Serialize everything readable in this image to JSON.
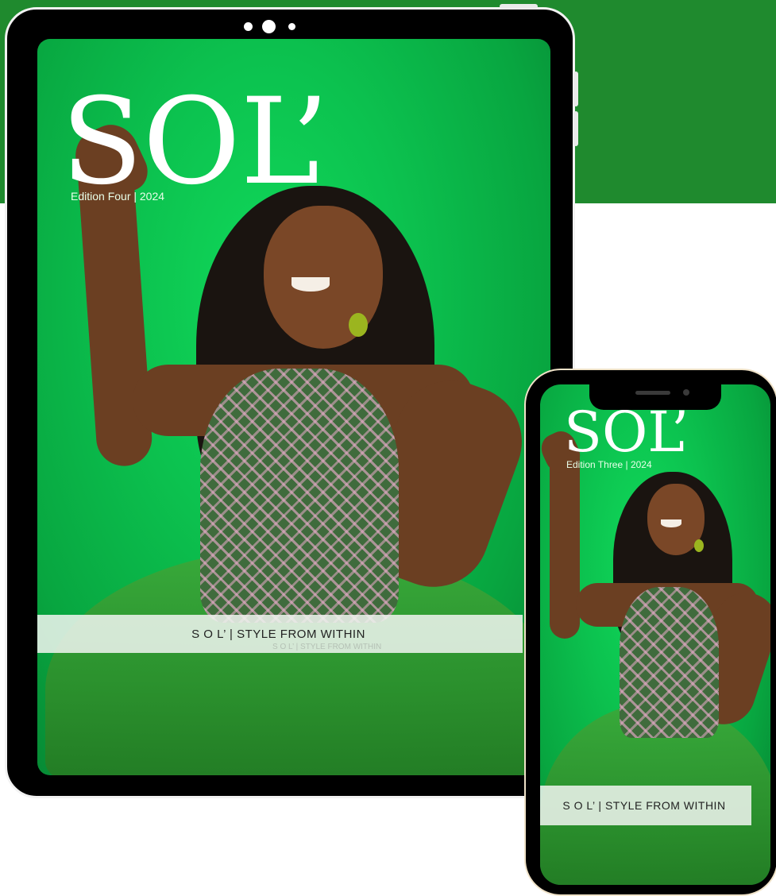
{
  "colors": {
    "band": "#1f8a2e",
    "screen_green": "#0cc24f",
    "phone_frame_trim": "#efe2c8"
  },
  "tablet": {
    "masthead": "SOL’",
    "edition": "Edition Four |  2024",
    "banner": "S O L’  | STYLE FROM WITHIN",
    "banner_ghost": "S O L’  | STYLE FROM WITHIN"
  },
  "phone": {
    "masthead": "SOL’",
    "edition": "Edition Three |  2024",
    "banner": "S O L’  | STYLE FROM WITHIN"
  }
}
